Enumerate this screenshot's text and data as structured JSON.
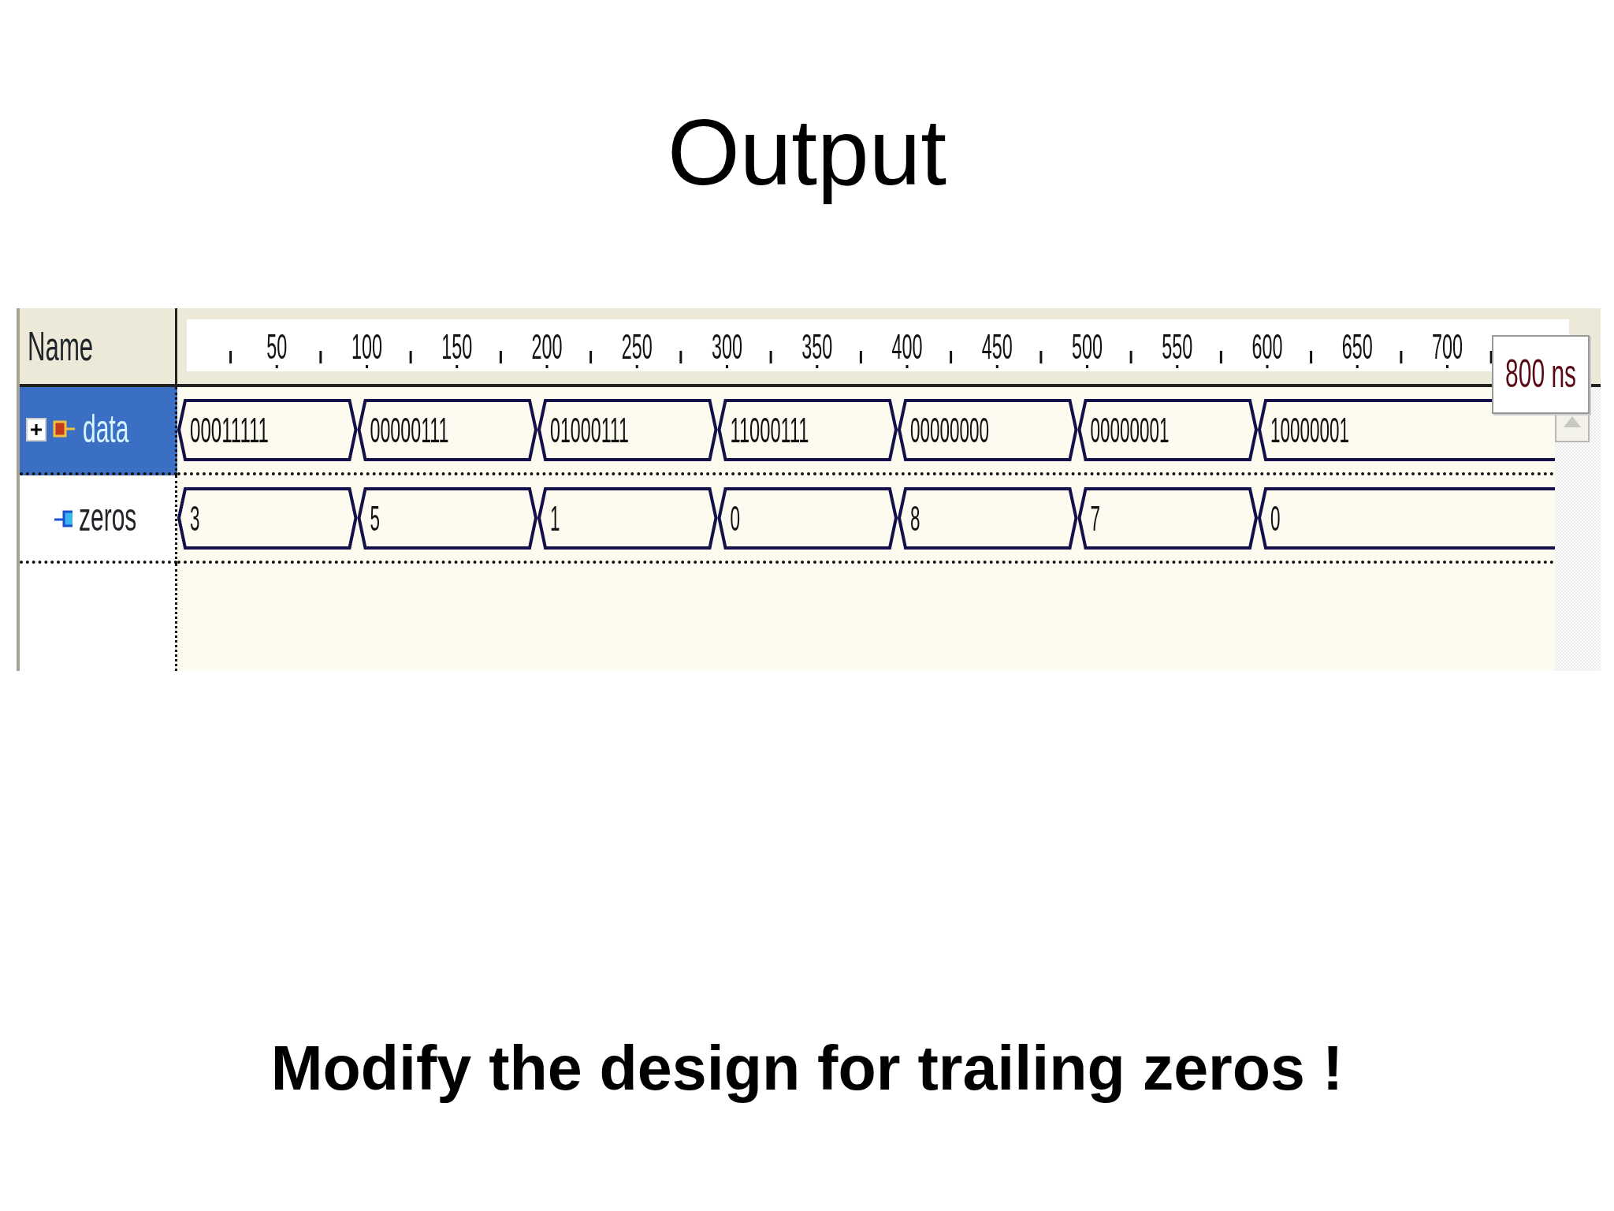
{
  "slide": {
    "title": "Output",
    "footer": "Modify the design for trailing zeros !"
  },
  "waveform": {
    "name_header": "Name",
    "ruler": [
      "50",
      "100",
      "150",
      "200",
      "250",
      "300",
      "350",
      "400",
      "450",
      "500",
      "550",
      "600",
      "650",
      "700"
    ],
    "cursor_time": "800 ns",
    "signals": [
      {
        "name": "data",
        "kind": "input",
        "expandable": true,
        "selected": true,
        "segments": [
          "00011111",
          "00000111",
          "01000111",
          "11000111",
          "00000000",
          "00000001",
          "10000001"
        ]
      },
      {
        "name": "zeros",
        "kind": "output",
        "expandable": false,
        "selected": false,
        "segments": [
          "3",
          "5",
          "1",
          "0",
          "8",
          "7",
          "0"
        ]
      }
    ]
  }
}
